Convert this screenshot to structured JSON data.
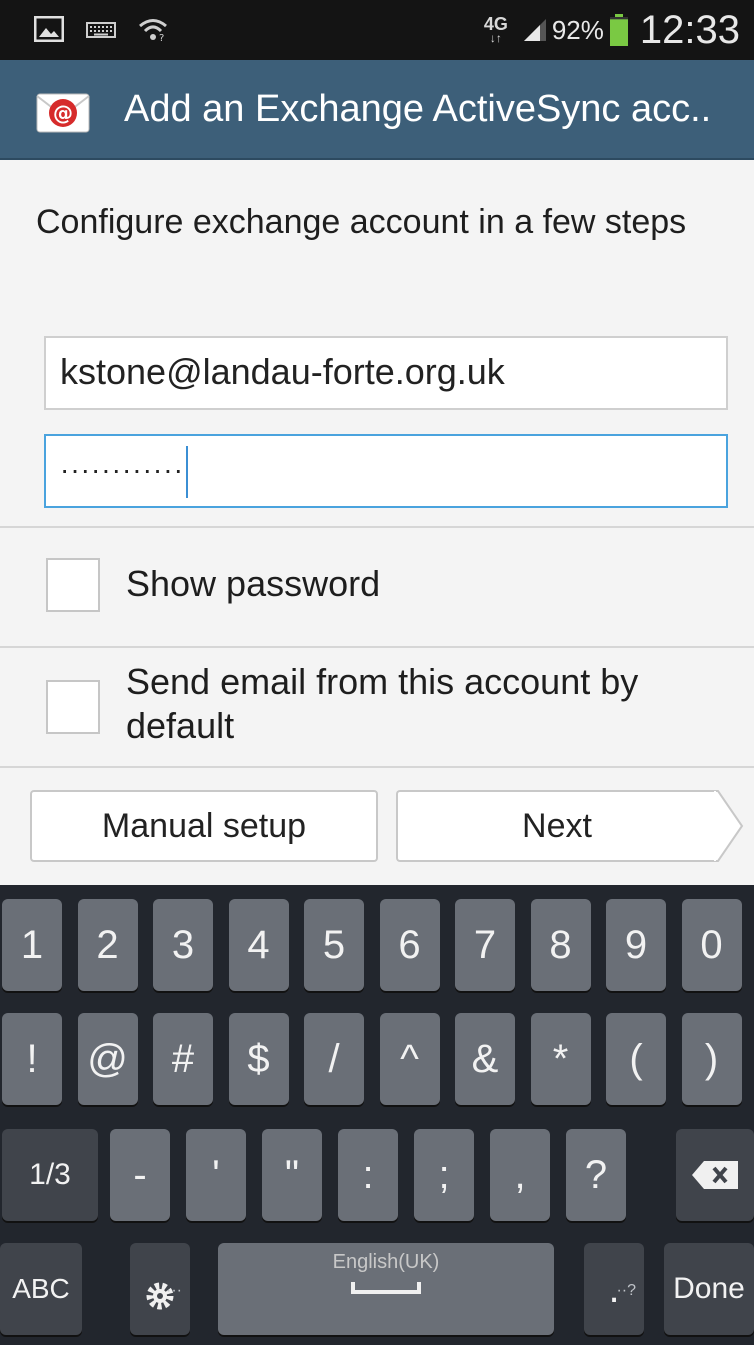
{
  "status_bar": {
    "icons_left": [
      "image-icon",
      "keyboard-icon",
      "wifi-icon"
    ],
    "network_type": "4G",
    "network_sub": "↓↑",
    "battery_percent": "92%",
    "battery_level": 0.92,
    "time": "12:33"
  },
  "action_bar": {
    "app_icon": "email-app-icon",
    "title": "Add an Exchange ActiveSync acc..",
    "accent_color": "#3d5f79"
  },
  "form": {
    "intro": "Configure exchange account in a few steps",
    "email_value": "kstone@landau-forte.org.uk",
    "password_value": "············",
    "show_password_label": "Show password",
    "show_password_checked": false,
    "default_account_label": "Send email from this account by default",
    "default_account_checked": false,
    "manual_setup_label": "Manual setup",
    "next_label": "Next"
  },
  "keyboard": {
    "row1": [
      "1",
      "2",
      "3",
      "4",
      "5",
      "6",
      "7",
      "8",
      "9",
      "0"
    ],
    "row2": [
      "!",
      "@",
      "#",
      "$",
      "/",
      "^",
      "&",
      "*",
      "(",
      ")"
    ],
    "row3": [
      "1/3",
      "-",
      "'",
      "\"",
      ":",
      ";",
      ",",
      "?"
    ],
    "row4": {
      "abc": "ABC",
      "settings_sub": "···",
      "space_language": "English(UK)",
      "period": ".",
      "period_sub": "··?",
      "done": "Done"
    },
    "backspace_icon": "backspace-icon",
    "settings_icon": "gear-icon"
  }
}
